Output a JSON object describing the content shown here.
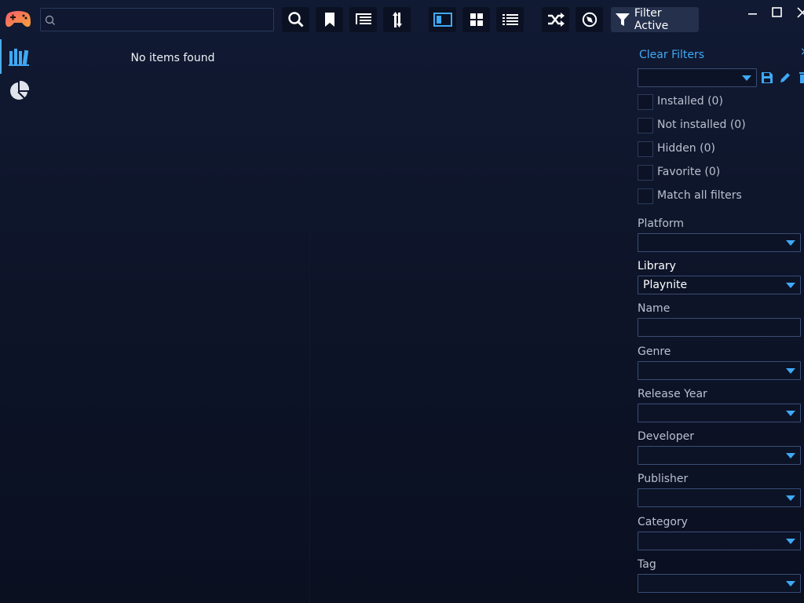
{
  "toolbar": {
    "search_placeholder": "",
    "filter_label": "Filter Active"
  },
  "list": {
    "empty_message": "No items found"
  },
  "filter_panel": {
    "clear_label": "Clear Filters",
    "close_glyph": "×",
    "preset_value": "",
    "checkboxes": [
      {
        "label": "Installed (0)",
        "checked": false
      },
      {
        "label": "Not installed (0)",
        "checked": false
      },
      {
        "label": "Hidden (0)",
        "checked": false
      },
      {
        "label": "Favorite (0)",
        "checked": false
      },
      {
        "label": "Match all filters",
        "checked": false
      }
    ],
    "fields": [
      {
        "label": "Platform",
        "value": "",
        "type": "dropdown"
      },
      {
        "label": "Library",
        "value": "Playnite",
        "type": "dropdown"
      },
      {
        "label": "Name",
        "value": "",
        "type": "text"
      },
      {
        "label": "Genre",
        "value": "",
        "type": "dropdown"
      },
      {
        "label": "Release Year",
        "value": "",
        "type": "dropdown"
      },
      {
        "label": "Developer",
        "value": "",
        "type": "dropdown"
      },
      {
        "label": "Publisher",
        "value": "",
        "type": "dropdown"
      },
      {
        "label": "Category",
        "value": "",
        "type": "dropdown"
      },
      {
        "label": "Tag",
        "value": "",
        "type": "dropdown"
      }
    ]
  },
  "colors": {
    "accent": "#3fa9f5",
    "background": "#0d1428"
  }
}
